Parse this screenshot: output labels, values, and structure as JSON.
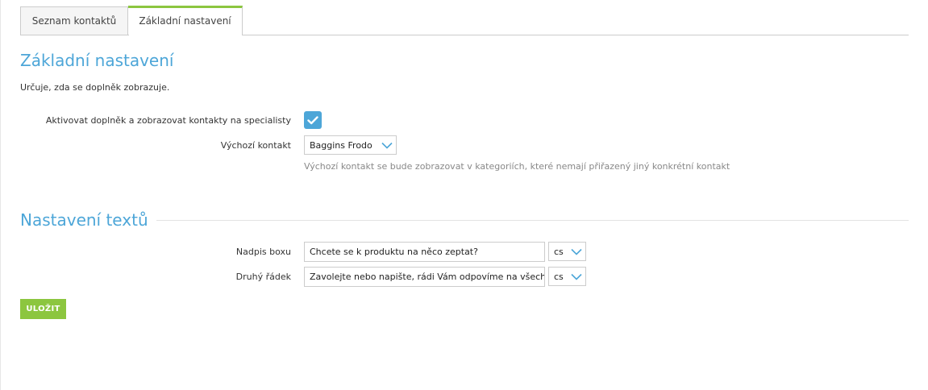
{
  "tabs": [
    {
      "label": "Seznam kontaktů"
    },
    {
      "label": "Základní nastavení"
    }
  ],
  "basic": {
    "title": "Základní nastavení",
    "description": "Určuje, zda se doplněk zobrazuje.",
    "activate_label": "Aktivovat doplněk a zobrazovat kontakty na specialisty",
    "activate_checked": true,
    "default_contact_label": "Výchozí kontakt",
    "default_contact_value": "Baggins Frodo",
    "default_contact_hint": "Výchozí kontakt se bude zobrazovat v kategoriích, které nemají přiřazený jiný konkrétní kontakt"
  },
  "texts": {
    "title": "Nastavení textů",
    "rows": [
      {
        "label": "Nadpis boxu",
        "value": "Chcete se k produktu na něco zeptat?",
        "lang": "cs"
      },
      {
        "label": "Druhý řádek",
        "value": "Zavolejte nebo napište, rádi Vám odpovíme na všechny d",
        "lang": "cs"
      }
    ]
  },
  "save_label": "ULOŽIT",
  "colors": {
    "accent_green": "#8cc63f",
    "accent_blue": "#4da6d8"
  }
}
